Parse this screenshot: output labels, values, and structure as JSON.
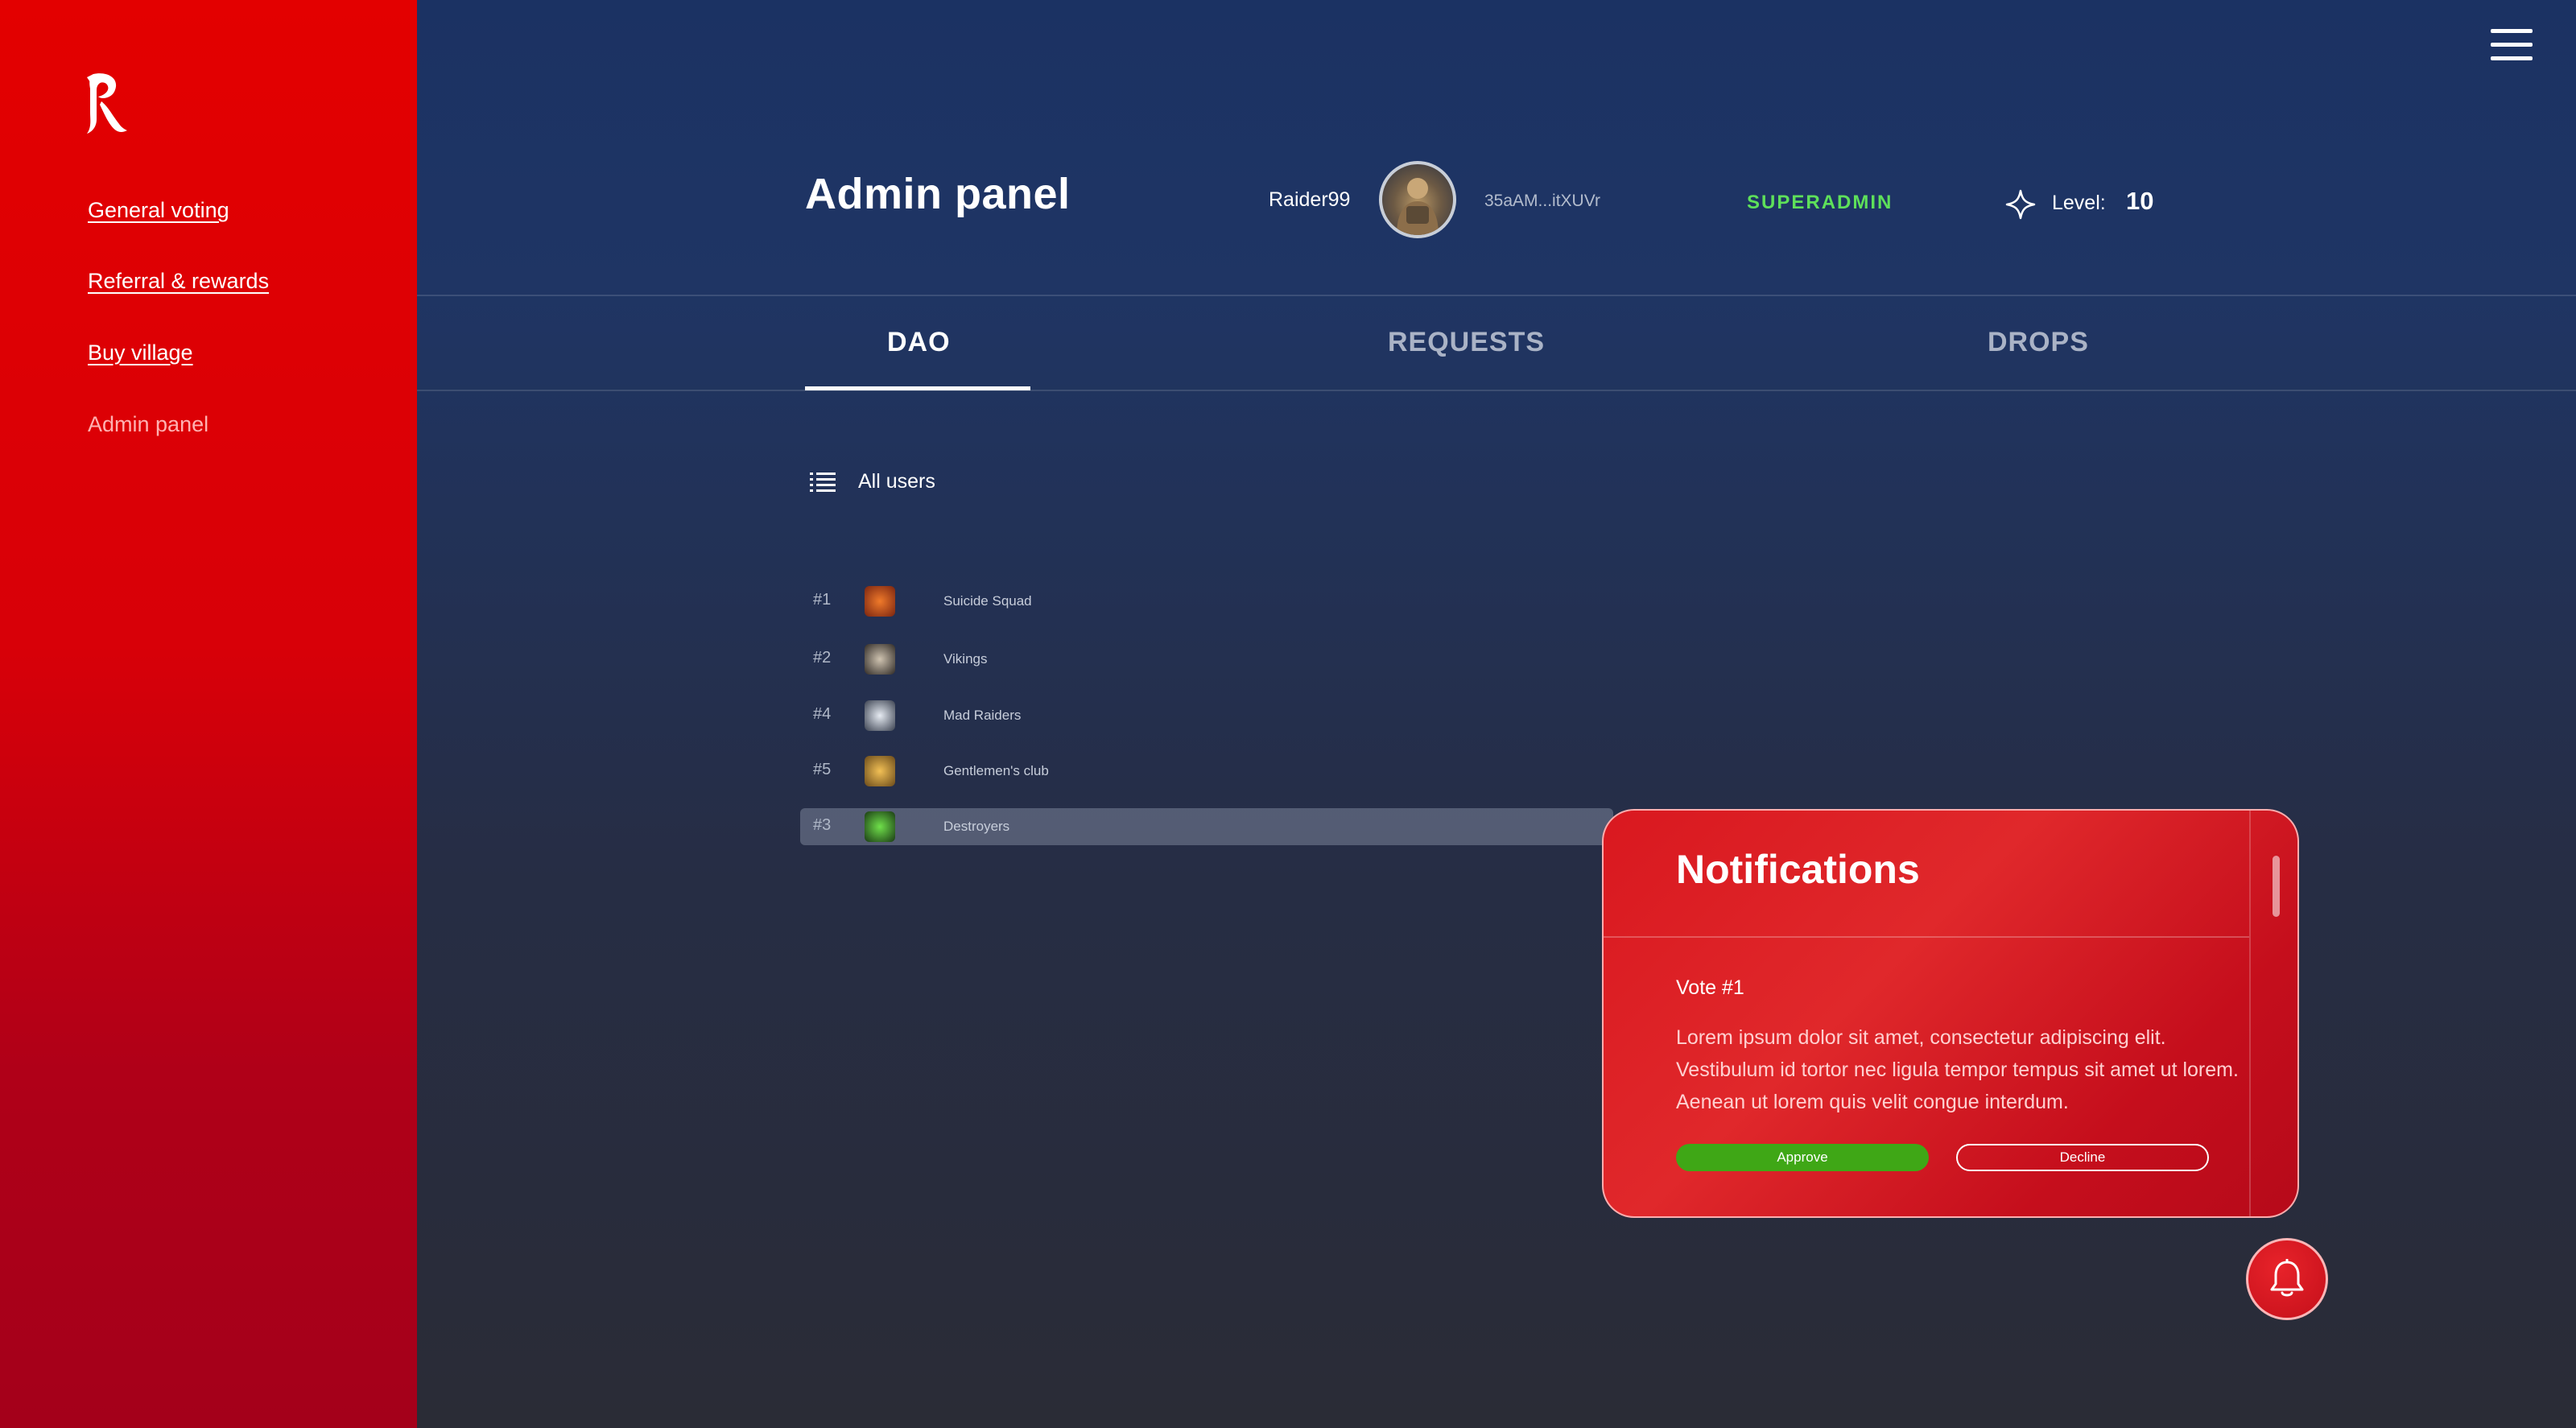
{
  "sidebar": {
    "logo_icon": "raider-r-logo",
    "items": [
      {
        "label": "General voting",
        "current": false
      },
      {
        "label": "Referral & rewards",
        "current": false
      },
      {
        "label": "Buy village",
        "current": false
      },
      {
        "label": "Admin panel",
        "current": true
      }
    ]
  },
  "header": {
    "title": "Admin panel",
    "username": "Raider99",
    "wallet": "35aAM...itXUVr",
    "role": "SUPERADMIN",
    "level_label": "Level:",
    "level_value": "10"
  },
  "tabs": [
    {
      "label": "DAO",
      "active": true
    },
    {
      "label": "REQUESTS",
      "active": false
    },
    {
      "label": "DROPS",
      "active": false
    }
  ],
  "list": {
    "title": "All users",
    "rows": [
      {
        "rank": "#1",
        "name": "Suicide Squad",
        "selected": false,
        "color": "#d8541a"
      },
      {
        "rank": "#2",
        "name": "Vikings",
        "selected": false,
        "color": "#8a7e70"
      },
      {
        "rank": "#4",
        "name": "Mad Raiders",
        "selected": false,
        "color": "#9aa4b2"
      },
      {
        "rank": "#5",
        "name": "Gentlemen's club",
        "selected": false,
        "color": "#d29a30"
      },
      {
        "rank": "#3",
        "name": "Destroyers",
        "selected": true,
        "color": "#3a9a28"
      }
    ]
  },
  "notifications": {
    "title": "Notifications",
    "item": {
      "title": "Vote #1",
      "body": "Lorem ipsum dolor sit amet, consectetur adipiscing elit. Vestibulum id tortor nec ligula tempor tempus sit amet ut lorem. Aenean ut lorem quis velit congue interdum.",
      "approve_label": "Approve",
      "decline_label": "Decline"
    }
  },
  "colors": {
    "accent_red": "#e30000",
    "role_green": "#5ee05a",
    "approve_green": "#3fa716"
  }
}
